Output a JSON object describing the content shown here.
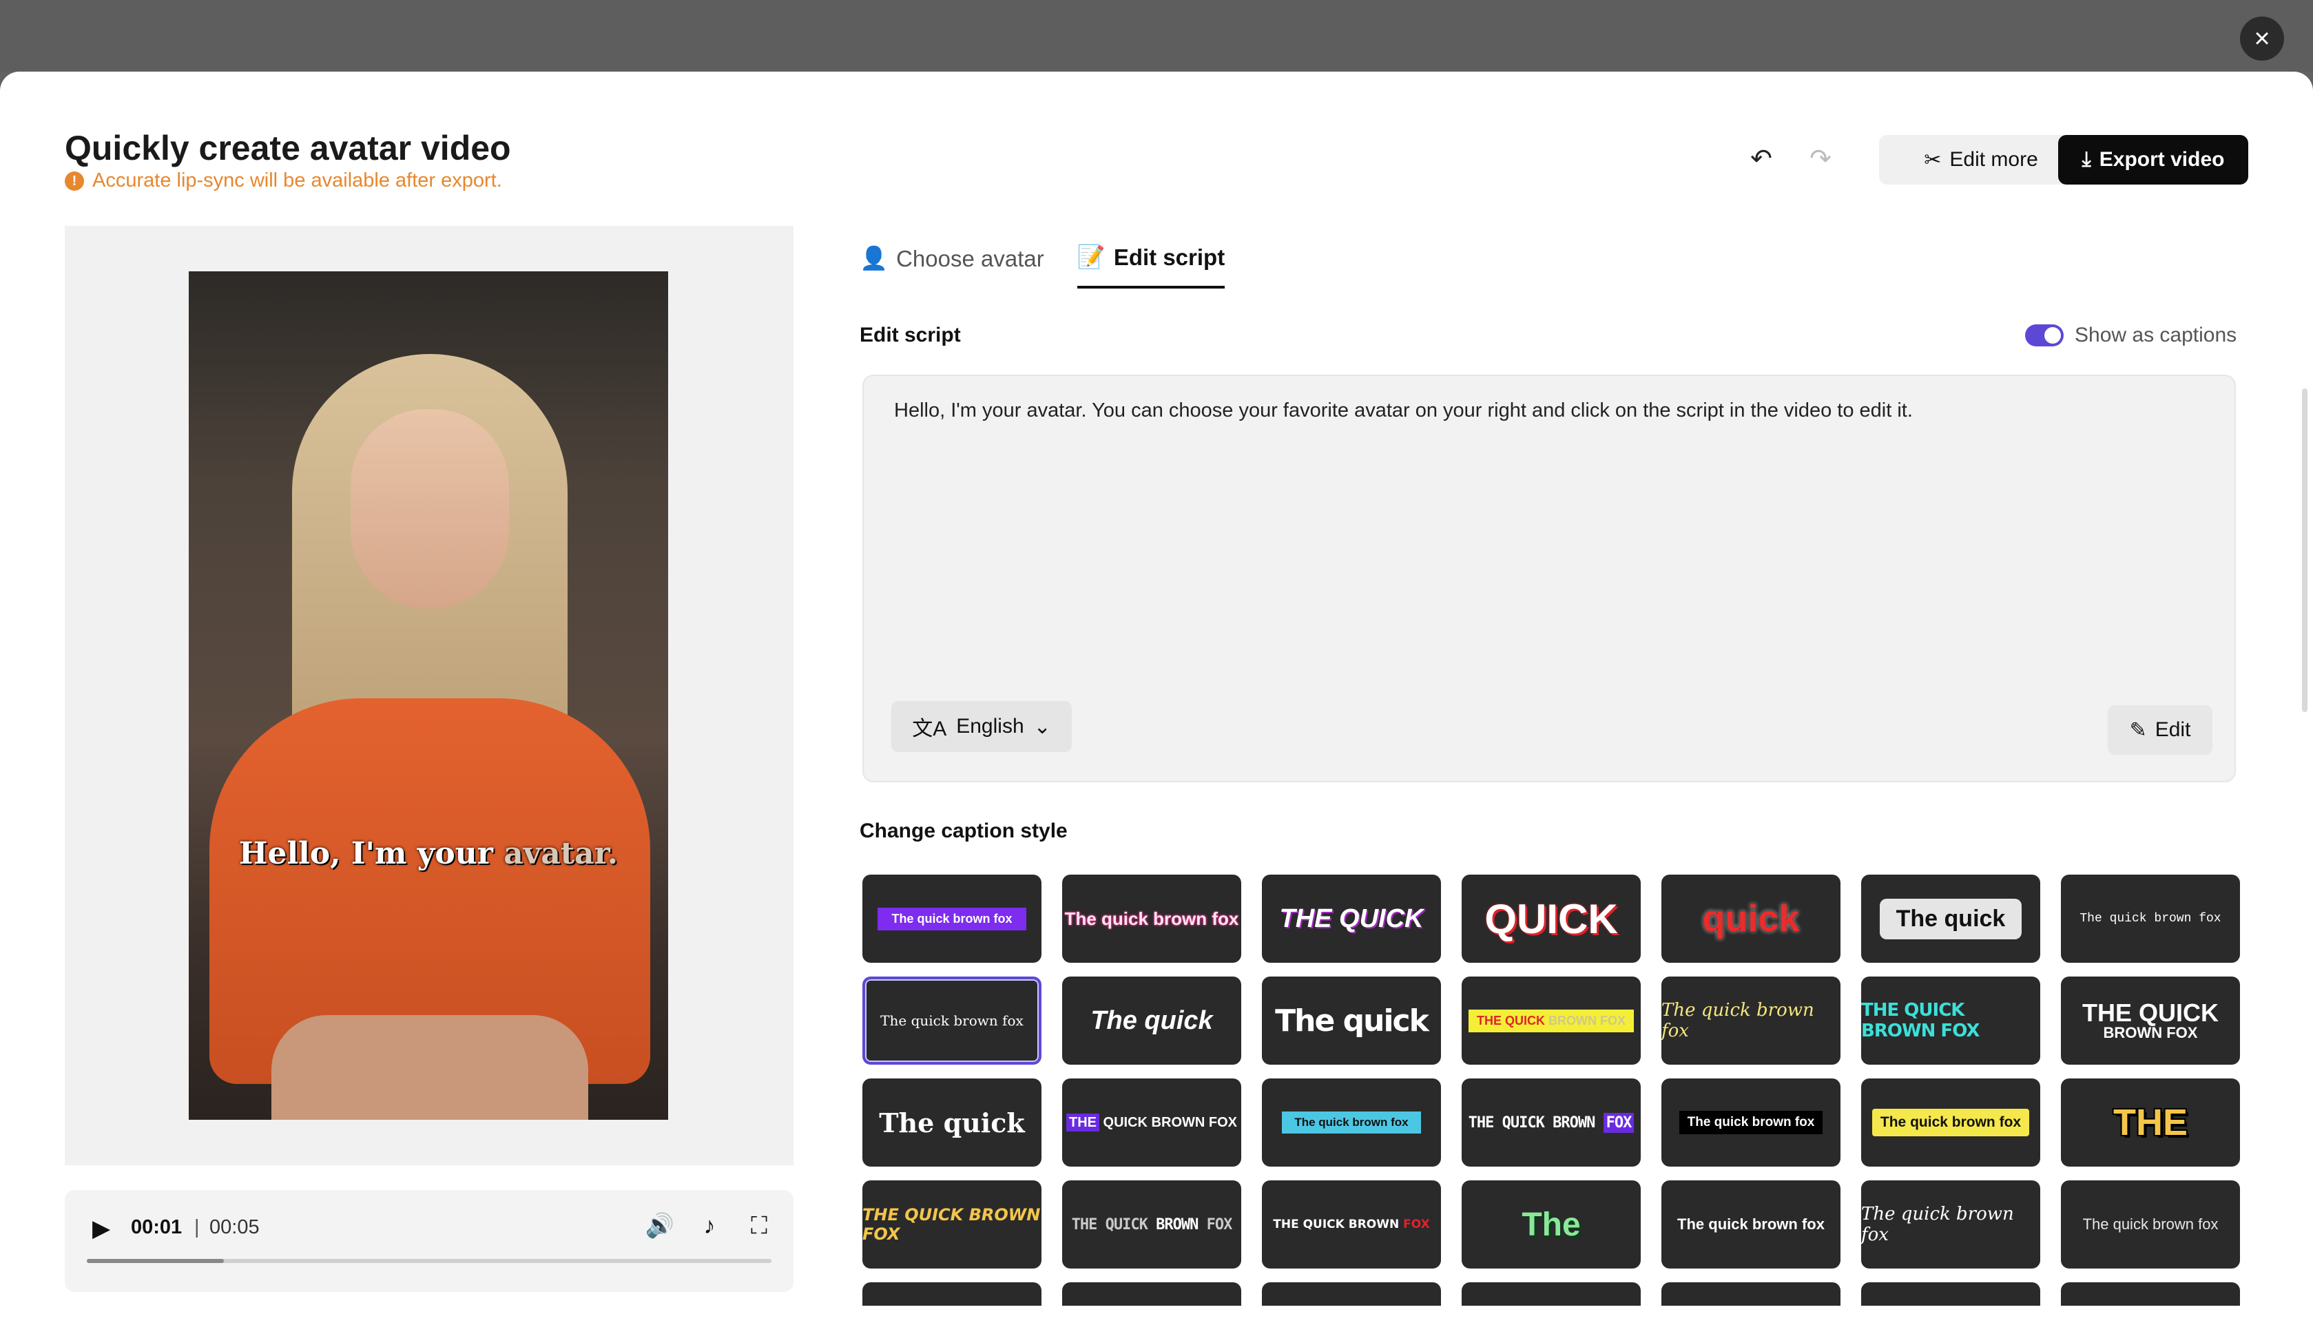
{
  "dialog": {
    "title": "Quickly create avatar video",
    "warning": "Accurate lip-sync will be available after export.",
    "close_icon": "×",
    "edit_more_label": "Edit more",
    "export_label": "Export video"
  },
  "preview": {
    "caption_main": "Hello, I'm your ",
    "caption_dim": "avatar.",
    "current_time": "00:01",
    "separator": "|",
    "total_time": "00:05",
    "progress": 0.2
  },
  "tabs": [
    {
      "label": "Choose avatar"
    },
    {
      "label": "Edit script"
    }
  ],
  "script": {
    "section_label": "Edit script",
    "show_captions_label": "Show as captions",
    "show_captions_on": true,
    "text": "Hello, I'm your avatar. You can choose your favorite avatar on your right and click on the script in the video to edit it.",
    "language": "English",
    "edit_label": "Edit"
  },
  "caption_style": {
    "section_label": "Change caption style",
    "tiles": [
      {
        "text": "The quick brown fox"
      },
      {
        "text": "The quick brown fox"
      },
      {
        "text": "THE QUICK"
      },
      {
        "text": "QUICK"
      },
      {
        "text": "quick"
      },
      {
        "text": "The quick"
      },
      {
        "text": "The quick brown fox"
      },
      {
        "text": "The quick brown fox"
      },
      {
        "text": "The quick"
      },
      {
        "text": "The quick"
      },
      {
        "text_a": "THE QUICK",
        "text_b": " BROWN FOX"
      },
      {
        "text": "The quick brown fox"
      },
      {
        "text": "THE QUICK BROWN FOX"
      },
      {
        "text_a": "THE QUICK",
        "text_b": "BROWN FOX"
      },
      {
        "text": "The quick"
      },
      {
        "text_a": "THE",
        "text_b": " QUICK BROWN FOX"
      },
      {
        "text": "The quick brown fox"
      },
      {
        "text_a": "THE QUICK BROWN ",
        "text_b": "FOX"
      },
      {
        "text": "The quick brown fox"
      },
      {
        "text": "The quick brown fox"
      },
      {
        "text": "THE"
      },
      {
        "text": "THE QUICK BROWN FOX"
      },
      {
        "text_a": "THE QUICK ",
        "text_w": "BROWN",
        "text_b": " FOX"
      },
      {
        "text_a": "THE QUICK BROWN ",
        "text_b": "FOX"
      },
      {
        "text": "The"
      },
      {
        "text": "The quick brown fox"
      },
      {
        "text": "The quick brown fox"
      },
      {
        "text": "The quick brown fox"
      }
    ]
  },
  "colors": {
    "accent": "#5b49d6",
    "warning": "#e8872d",
    "export_bg": "#0c0c0c"
  }
}
